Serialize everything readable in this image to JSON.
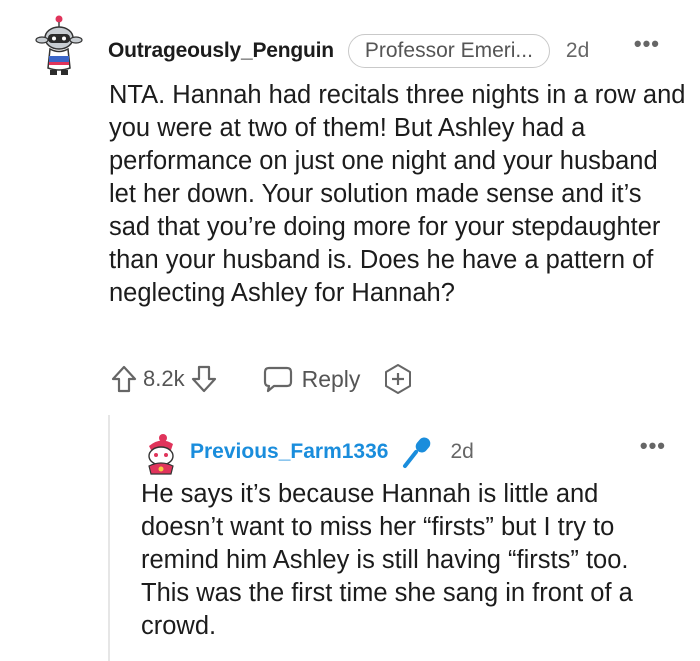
{
  "comment": {
    "username": "Outrageously_Penguin",
    "flair": "Professor Emeri...",
    "age": "2d",
    "more": "•••",
    "body": "NTA. Hannah had recitals three nights in a row and you were at two of them! But Ashley had a performance on just one night and your husband let her down. Your solution made sense and it’s sad that you’re doing more for your stepdaughter than your husband is. Does he have a pattern of neglecting Ashley for Hannah?",
    "score": "8.2k",
    "reply_label": "Reply",
    "icons": {
      "avatar": "penguin-avatar-icon",
      "upvote": "upvote-arrow-icon",
      "downvote": "downvote-arrow-icon",
      "reply": "speech-bubble-icon",
      "award": "award-plus-icon"
    }
  },
  "reply": {
    "username": "Previous_Farm1336",
    "age": "2d",
    "more": "•••",
    "badge_icon": "microphone-icon",
    "body": "He says it’s because Hannah is little and doesn’t want to miss her “firsts” but I try to remind him Ashley is still having “firsts” too. This was the first time she sang in front of a crowd."
  },
  "colors": {
    "text": "#1c1c1c",
    "meta": "#666666",
    "reply_username": "#1a8ddc",
    "thread_line": "#e6e6e6",
    "flair_border": "#c9c9c9"
  }
}
